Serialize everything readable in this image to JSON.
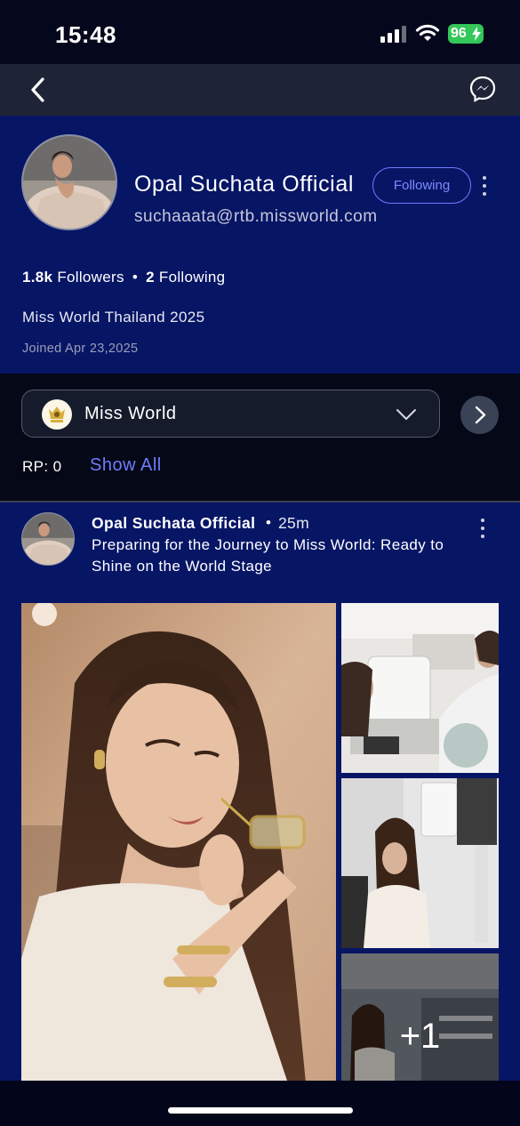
{
  "status_bar": {
    "time": "15:48",
    "battery": "96",
    "icons": [
      "cellular-signal-icon",
      "wifi-icon",
      "battery-charging-icon"
    ]
  },
  "nav": {
    "back_icon": "chevron-left-icon",
    "messenger_icon": "messenger-icon"
  },
  "profile": {
    "name": "Opal Suchata Official",
    "follow_label": "Following",
    "email": "suchaaata@rtb.missworld.com",
    "followers_count": "1.8k",
    "followers_label": "Followers",
    "separator": "•",
    "following_count": "2",
    "following_label": "Following",
    "bio": "Miss World Thailand 2025",
    "joined": "Joined Apr 23,2025"
  },
  "community": {
    "selected": "Miss World",
    "rp_label": "RP: 0",
    "show_all_label": "Show All"
  },
  "post": {
    "author": "Opal Suchata Official",
    "separator": "•",
    "time": "25m",
    "text": "Preparing for the Journey to Miss World: Ready to Shine on the World Stage",
    "images": [
      "portrait-with-glasses",
      "eye-exam-clinic",
      "optometry-equipment",
      "clinic-interior"
    ],
    "more_images_label": "+1"
  },
  "colors": {
    "profile_bg": "#071565",
    "accent": "#6f7cff",
    "page_bg": "#03061a",
    "nav_bg": "#1e2436",
    "battery": "#34c759"
  }
}
